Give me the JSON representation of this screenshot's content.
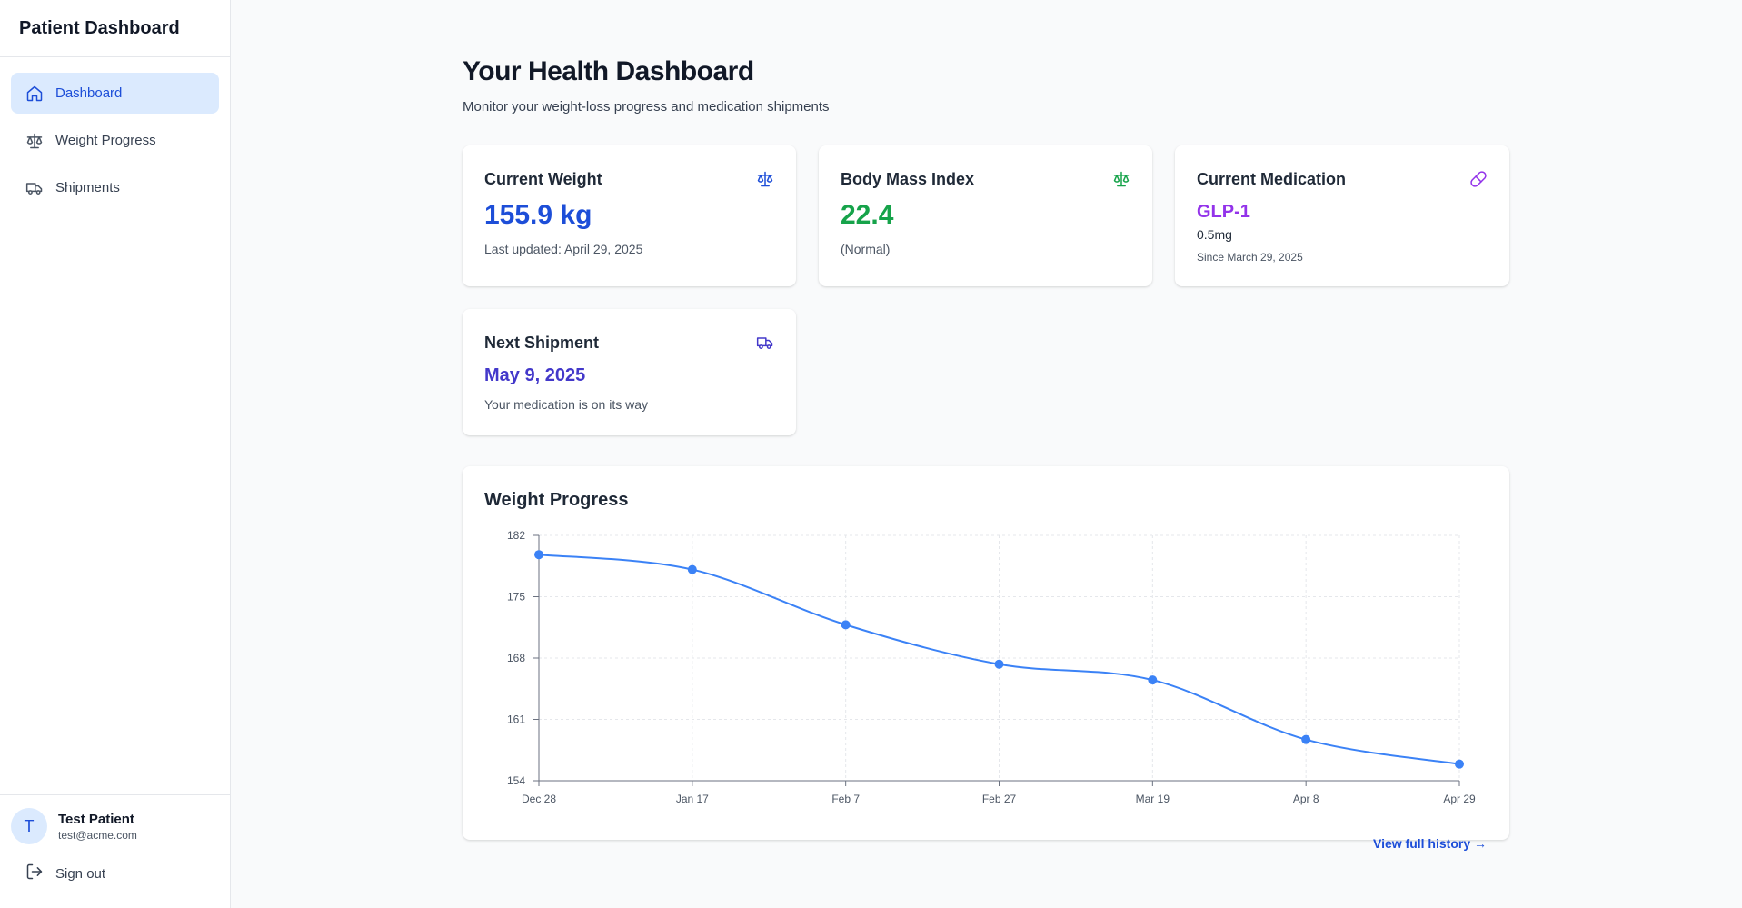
{
  "sidebar": {
    "title": "Patient Dashboard",
    "items": [
      {
        "label": "Dashboard",
        "icon": "home-icon",
        "active": true
      },
      {
        "label": "Weight Progress",
        "icon": "scale-icon",
        "active": false
      },
      {
        "label": "Shipments",
        "icon": "truck-icon",
        "active": false
      }
    ],
    "user": {
      "initial": "T",
      "name": "Test Patient",
      "email": "test@acme.com"
    },
    "signout_label": "Sign out"
  },
  "header": {
    "title": "Your Health Dashboard",
    "subtitle": "Monitor your weight-loss progress and medication shipments"
  },
  "cards": {
    "weight": {
      "title": "Current Weight",
      "value": "155.9 kg",
      "meta": "Last updated: April 29, 2025",
      "icon": "scale-icon"
    },
    "bmi": {
      "title": "Body Mass Index",
      "value": "22.4",
      "meta": "(Normal)",
      "icon": "scale-icon"
    },
    "medication": {
      "title": "Current Medication",
      "value": "GLP-1",
      "dose": "0.5mg",
      "meta": "Since March 29, 2025",
      "icon": "pill-icon"
    },
    "shipment": {
      "title": "Next Shipment",
      "value": "May 9, 2025",
      "meta": "Your medication is on its way",
      "icon": "truck-icon"
    }
  },
  "colors": {
    "blue": "#1d4ed8",
    "green": "#16a34a",
    "purple": "#9333ea",
    "indigo": "#4338ca",
    "line": "#3b82f6"
  },
  "chart_section": {
    "title": "Weight Progress",
    "link": "View full history →"
  },
  "chart_data": {
    "type": "line",
    "x": [
      "Dec 28",
      "Jan 17",
      "Feb 7",
      "Feb 27",
      "Mar 19",
      "Apr 8",
      "Apr 29"
    ],
    "values": [
      179.8,
      178.1,
      171.8,
      167.3,
      165.5,
      158.7,
      155.9
    ],
    "yticks": [
      154,
      161,
      168,
      175,
      182
    ],
    "ylim": [
      154,
      182
    ],
    "grid": true,
    "xlabel": "",
    "ylabel": ""
  }
}
